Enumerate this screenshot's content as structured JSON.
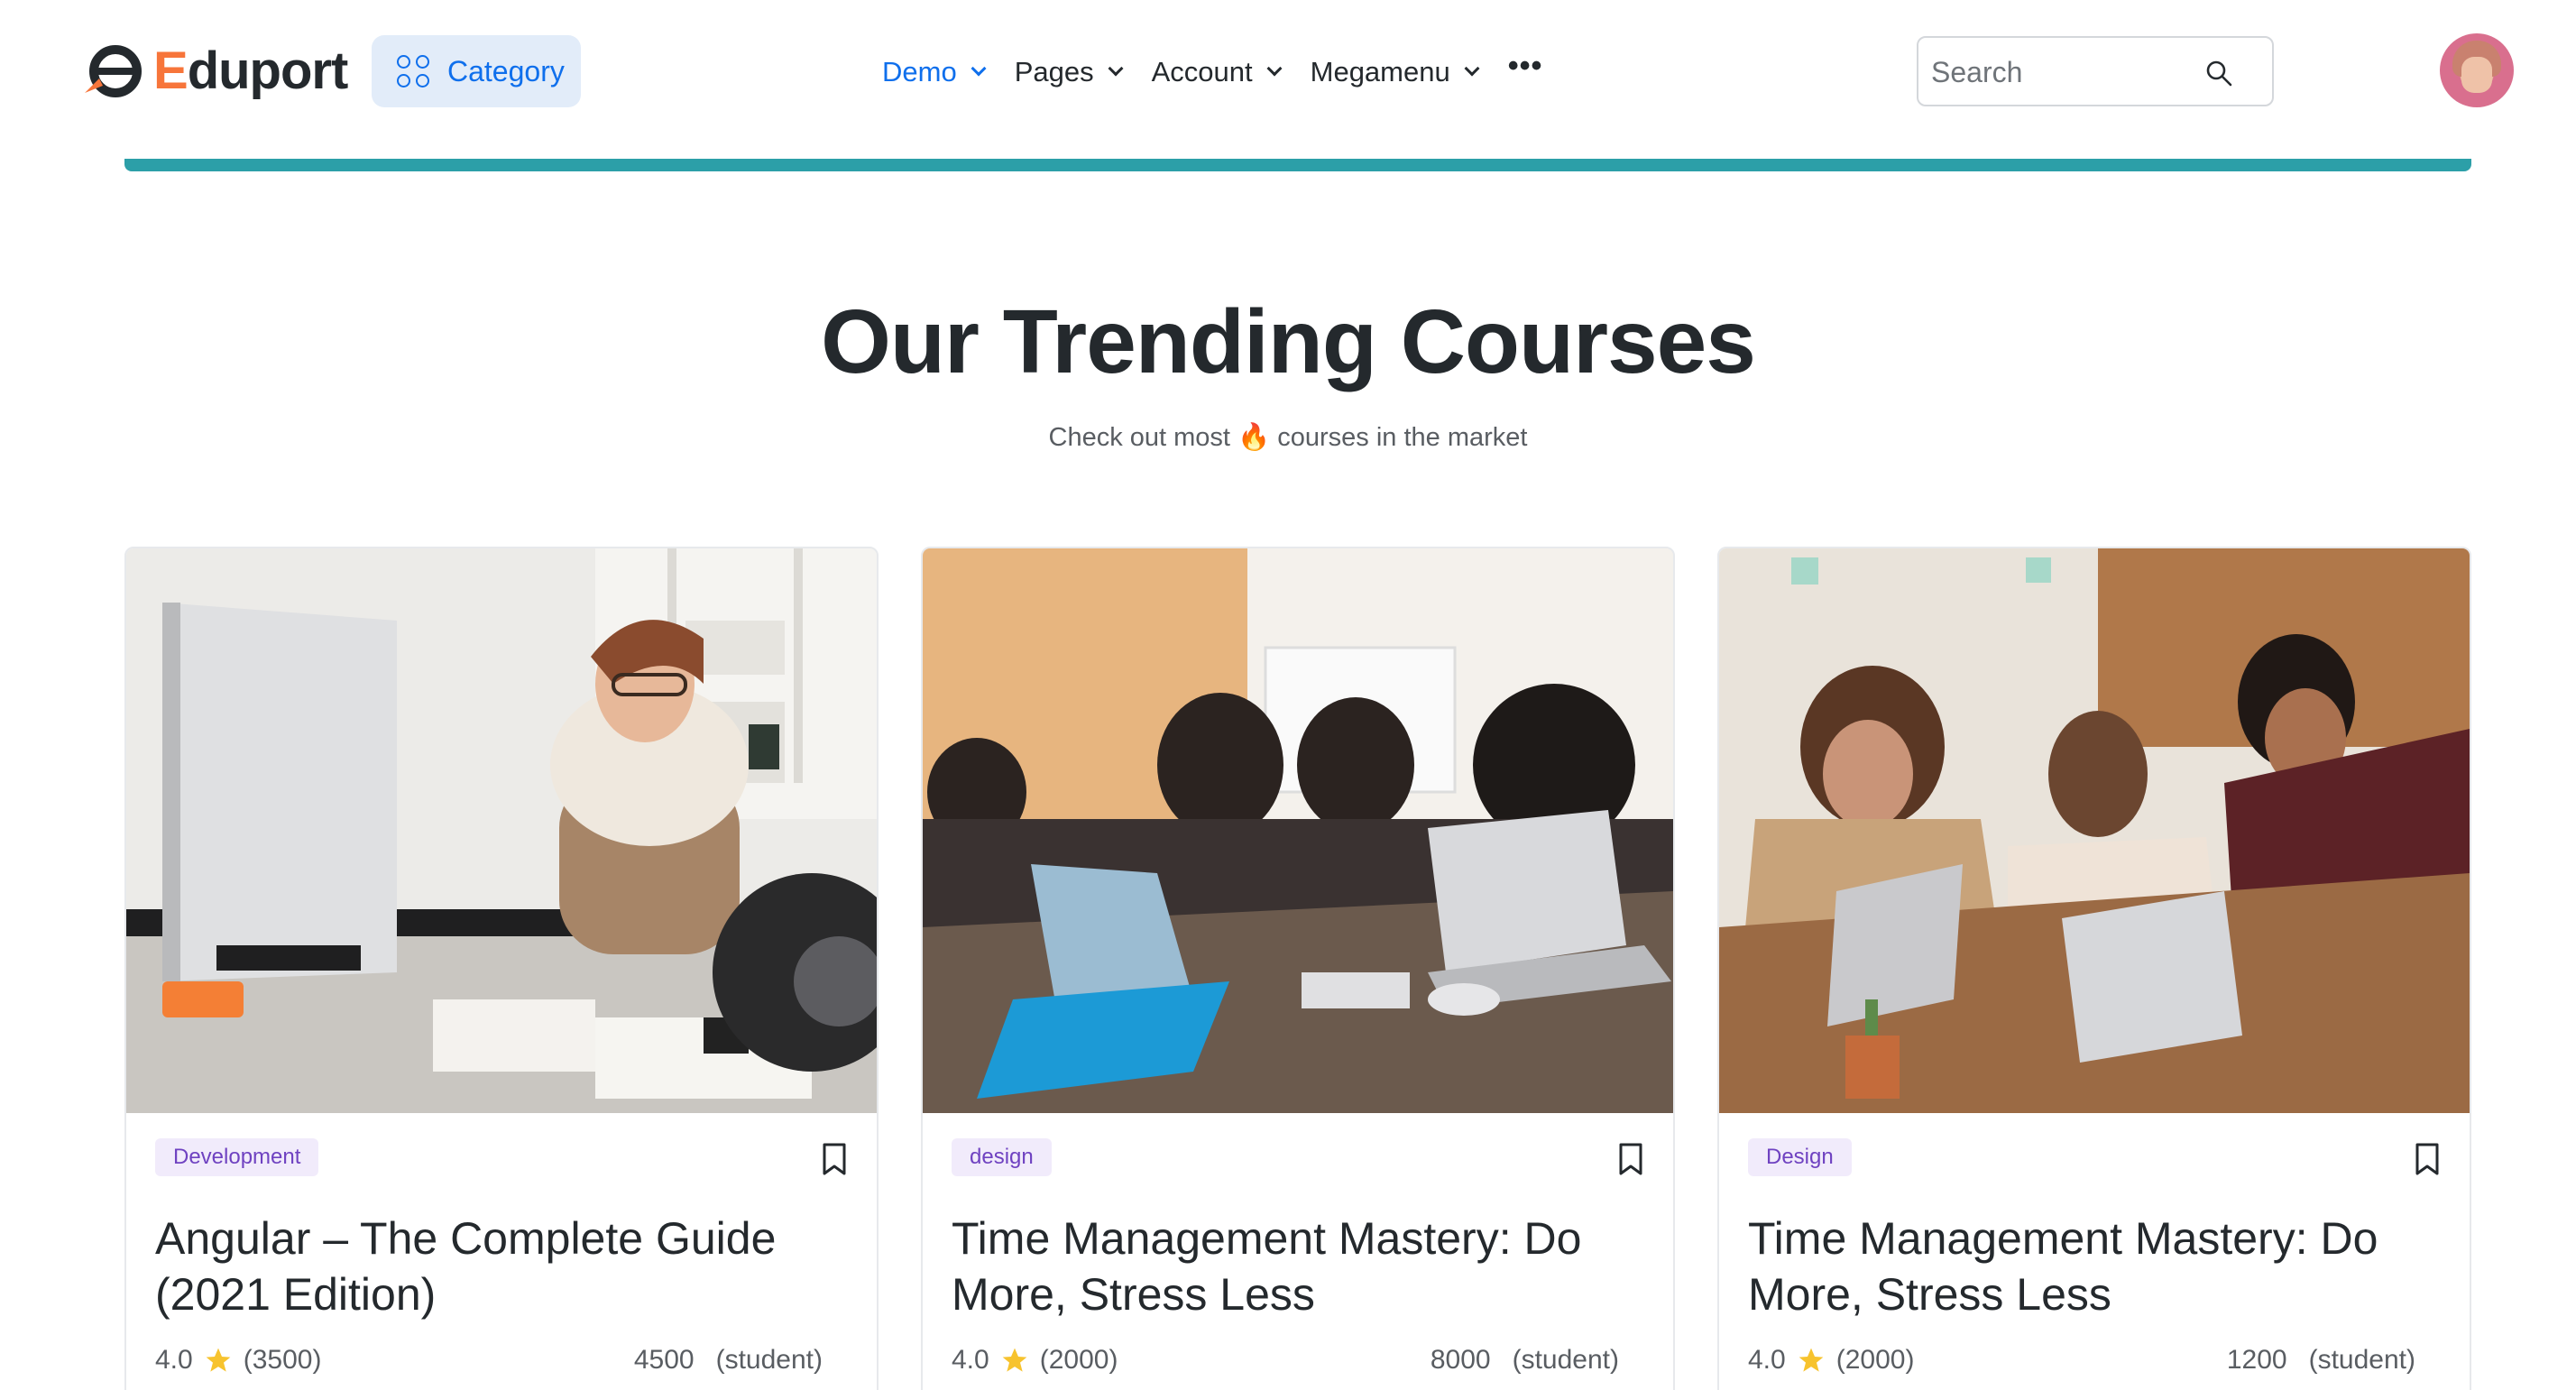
{
  "brand": {
    "name_first": "E",
    "name_rest": "duport",
    "accent_color": "#f7753a"
  },
  "header": {
    "category_label": "Category",
    "nav": [
      {
        "label": "Demo",
        "active": true
      },
      {
        "label": "Pages",
        "active": false
      },
      {
        "label": "Account",
        "active": false
      },
      {
        "label": "Megamenu",
        "active": false
      }
    ],
    "more_label": "•••",
    "search_placeholder": "Search"
  },
  "colors": {
    "primary": "#0f6fec",
    "accent_bar": "#2c9fa8",
    "badge_text": "#6f42c1",
    "star": "#f7c32e"
  },
  "section": {
    "title": "Our Trending Courses",
    "subtitle_before": "Check out most",
    "subtitle_emoji": "🔥",
    "subtitle_after": "courses in the market"
  },
  "courses": [
    {
      "tag": "Development",
      "title": "Angular – The Complete Guide (2021 Edition)",
      "rating": "4.0",
      "reviews": "(3500)",
      "students": "4500",
      "students_label": "(student)",
      "image_icon": "woman-at-computer-photo"
    },
    {
      "tag": "design",
      "title": "Time Management Mastery: Do More, Stress Less",
      "rating": "4.0",
      "reviews": "(2000)",
      "students": "8000",
      "students_label": "(student)",
      "image_icon": "meeting-table-photo"
    },
    {
      "tag": "Design",
      "title": "Time Management Mastery: Do More, Stress Less",
      "rating": "4.0",
      "reviews": "(2000)",
      "students": "1200",
      "students_label": "(student)",
      "image_icon": "team-laptops-photo"
    }
  ]
}
